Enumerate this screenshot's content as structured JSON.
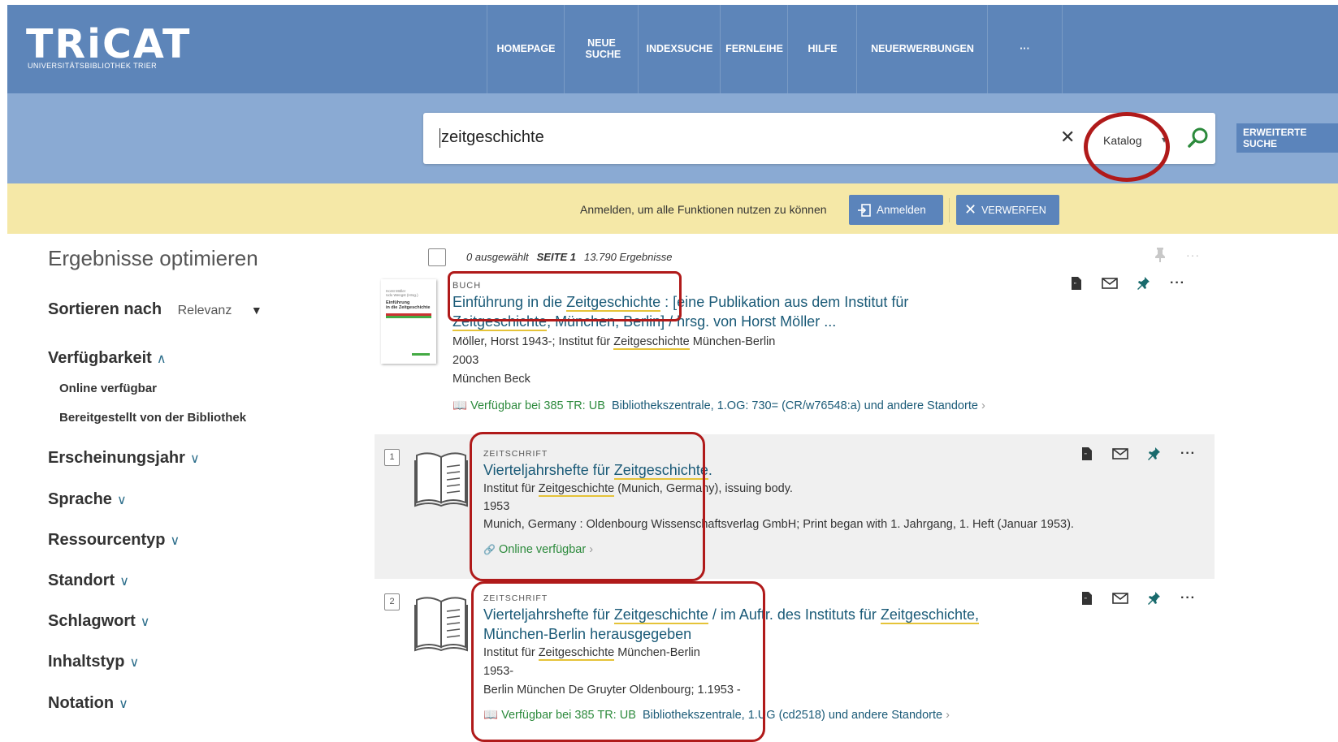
{
  "header": {
    "logo": "TRiCAT",
    "logo_sub": "UNIVERSITÄTSBIBLIOTHEK TRIER",
    "nav": [
      "HOMEPAGE",
      "NEUE SUCHE",
      "INDEXSUCHE",
      "FERNLEIHE",
      "HILFE",
      "NEUERWERBUNGEN",
      "···"
    ]
  },
  "search": {
    "query": "zeitgeschichte",
    "scope": "Katalog",
    "advanced": "ERWEITERTE SUCHE"
  },
  "notice": {
    "text": "Anmelden, um alle Funktionen nutzen zu können",
    "login": "Anmelden",
    "dismiss": "VERWERFEN"
  },
  "sidebar": {
    "title": "Ergebnisse optimieren",
    "sort_label": "Sortieren nach",
    "sort_value": "Relevanz",
    "facets": [
      "Verfügbarkeit",
      "Erscheinungsjahr",
      "Sprache",
      "Ressourcentyp",
      "Standort",
      "Schlagwort",
      "Inhaltstyp",
      "Notation"
    ],
    "availability_options": [
      "Online verfügbar",
      "Bereitgestellt von der Bibliothek"
    ]
  },
  "results_header": {
    "selected": "0 ausgewählt",
    "page": "SEITE 1",
    "count": "13.790 Ergebnisse"
  },
  "results": [
    {
      "type": "BUCH",
      "title_line1_a": "Einführung in die ",
      "title_line1_hl": "Zeitgeschichte",
      "title_line1_b": " : [eine Publikation aus dem Institut für",
      "title_line2_hl": "Zeitgeschichte",
      "title_line2_b": ", München, Berlin] / hrsg. von Horst Möller ...",
      "author_a": "Möller, Horst 1943-; Institut für ",
      "author_hl": "Zeitgeschichte",
      "author_b": " München-Berlin",
      "year": "2003",
      "publisher": "München Beck",
      "avail": "Verfügbar bei 385 TR: UB",
      "location": "Bibliothekszentrale, 1.OG: 730= (CR/w76548:a) und andere Standorte",
      "thumb_authors": "Horst Möller\nUdo Wengst (Hrsg.)",
      "thumb_title": "Einführung\nin die Zeitgeschichte"
    },
    {
      "number": "1",
      "type": "ZEITSCHRIFT",
      "title_a": "Vierteljahrshefte für ",
      "title_hl": "Zeitgeschichte",
      "title_b": ".",
      "author_a": "Institut für ",
      "author_hl": "Zeitgeschichte",
      "author_b": " (Munich, Germany), issuing body.",
      "year": "1953",
      "publisher": "Munich, Germany : Oldenbourg Wissenschaftsverlag GmbH; Print began with 1. Jahrgang, 1. Heft (Januar 1953).",
      "avail": "Online verfügbar"
    },
    {
      "number": "2",
      "type": "ZEITSCHRIFT",
      "title_a": "Vierteljahrshefte für ",
      "title_hl": "Zeitgeschichte",
      "title_b": " / im Auftr. des Instituts für ",
      "title_hl2": "Zeitgeschichte,",
      "title_line2": "München-Berlin herausgegeben",
      "author_a": "Institut für ",
      "author_hl": "Zeitgeschichte",
      "author_b": " München-Berlin",
      "year": "1953-",
      "publisher": "Berlin München De Gruyter Oldenbourg; 1.1953 -",
      "avail": "Verfügbar bei 385 TR: UB",
      "location": "Bibliothekszentrale, 1.UG (cd2518) und andere Standorte"
    }
  ]
}
